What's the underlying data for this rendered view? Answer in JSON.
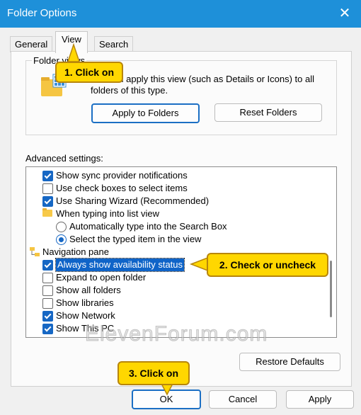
{
  "window": {
    "title": "Folder Options",
    "close_symbol": "✕"
  },
  "tabs": [
    {
      "label": "General"
    },
    {
      "label": "View"
    },
    {
      "label": "Search"
    }
  ],
  "folder_views": {
    "legend": "Folder views",
    "description": "You can apply this view (such as Details or Icons) to all folders of this type.",
    "apply_button": "Apply to Folders",
    "reset_button": "Reset Folders"
  },
  "advanced": {
    "label": "Advanced settings:",
    "items": [
      {
        "type": "checkbox",
        "checked": true,
        "text": "Show sync provider notifications"
      },
      {
        "type": "checkbox",
        "checked": false,
        "text": "Use check boxes to select items"
      },
      {
        "type": "checkbox",
        "checked": true,
        "text": "Use Sharing Wizard (Recommended)"
      },
      {
        "type": "folder",
        "text": "When typing into list view"
      },
      {
        "type": "radio",
        "checked": false,
        "text": "Automatically type into the Search Box"
      },
      {
        "type": "radio",
        "checked": true,
        "text": "Select the typed item in the view"
      },
      {
        "type": "nav",
        "text": "Navigation pane"
      },
      {
        "type": "checkbox",
        "checked": true,
        "text": "Always show availability status",
        "selected": true
      },
      {
        "type": "checkbox",
        "checked": false,
        "text": "Expand to open folder"
      },
      {
        "type": "checkbox",
        "checked": false,
        "text": "Show all folders"
      },
      {
        "type": "checkbox",
        "checked": false,
        "text": "Show libraries"
      },
      {
        "type": "checkbox",
        "checked": true,
        "text": "Show Network"
      },
      {
        "type": "checkbox",
        "checked": true,
        "text": "Show This PC"
      }
    ]
  },
  "restore_defaults_button": "Restore Defaults",
  "footer": {
    "ok": "OK",
    "cancel": "Cancel",
    "apply": "Apply"
  },
  "callouts": {
    "one": "1. Click on",
    "two": "2. Check or uncheck",
    "three": "3. Click on"
  },
  "watermark": "ElevenForum.com",
  "colors": {
    "titlebar": "#1e90d9",
    "accent": "#1667c4",
    "callout": "#ffd700"
  }
}
